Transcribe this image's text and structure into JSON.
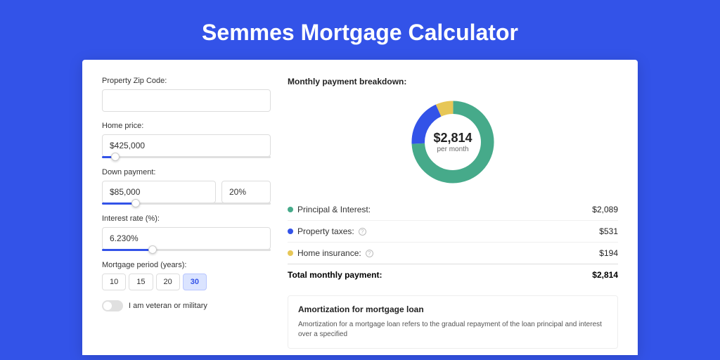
{
  "title": "Semmes Mortgage Calculator",
  "form": {
    "zip_label": "Property Zip Code:",
    "zip_value": "",
    "home_price_label": "Home price:",
    "home_price_value": "$425,000",
    "home_price_slider_pct": 8,
    "down_payment_label": "Down payment:",
    "down_payment_value": "$85,000",
    "down_payment_pct_value": "20%",
    "down_payment_slider_pct": 20,
    "interest_label": "Interest rate (%):",
    "interest_value": "6.230%",
    "interest_slider_pct": 30,
    "period_label": "Mortgage period (years):",
    "period_options": [
      "10",
      "15",
      "20",
      "30"
    ],
    "period_selected": "30",
    "veteran_label": "I am veteran or military"
  },
  "breakdown": {
    "title": "Monthly payment breakdown:",
    "center_value": "$2,814",
    "center_label": "per month",
    "items": [
      {
        "label": "Principal & Interest:",
        "value": "$2,089",
        "color": "green",
        "help": false
      },
      {
        "label": "Property taxes:",
        "value": "$531",
        "color": "blue",
        "help": true
      },
      {
        "label": "Home insurance:",
        "value": "$194",
        "color": "yellow",
        "help": true
      }
    ],
    "total_label": "Total monthly payment:",
    "total_value": "$2,814"
  },
  "amortization": {
    "title": "Amortization for mortgage loan",
    "text": "Amortization for a mortgage loan refers to the gradual repayment of the loan principal and interest over a specified"
  },
  "chart_data": {
    "type": "pie",
    "title": "Monthly payment breakdown",
    "categories": [
      "Principal & Interest",
      "Property taxes",
      "Home insurance"
    ],
    "values": [
      2089,
      531,
      194
    ],
    "colors": [
      "#46aa8a",
      "#3353e8",
      "#e7c757"
    ],
    "total": 2814
  }
}
